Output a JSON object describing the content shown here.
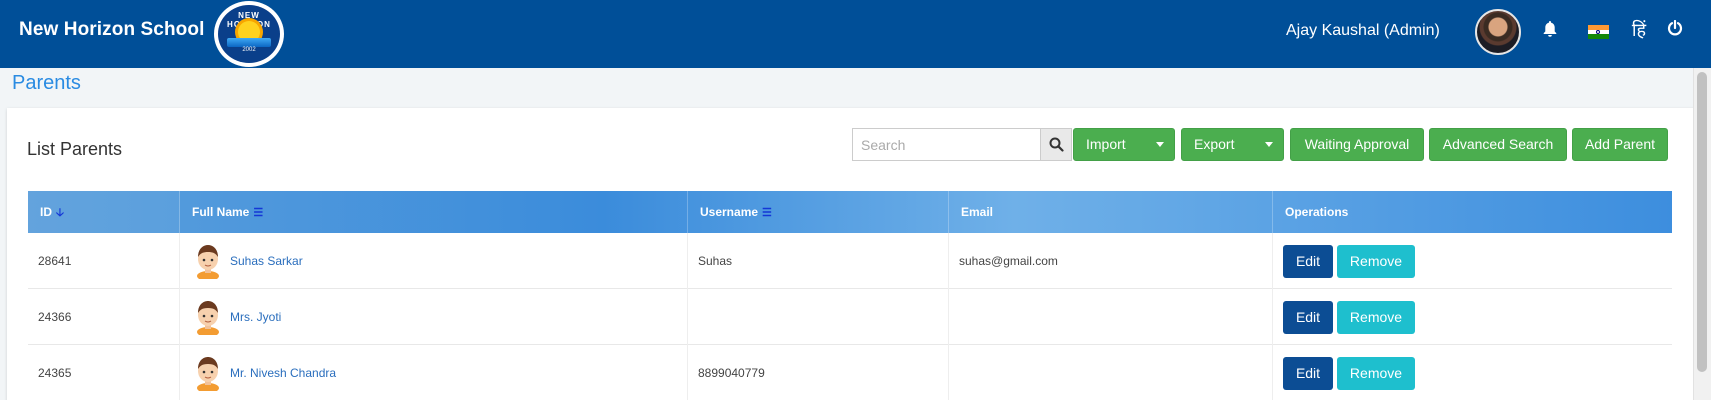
{
  "header": {
    "brand": "New Horizon School",
    "logo_text": "NEW HORIZON",
    "logo_year": "2002",
    "user_name": "Ajay Kaushal (Admin)",
    "icons": [
      "bell-icon",
      "india-flag-icon",
      "hindi-language-icon",
      "power-icon"
    ],
    "hindi_glyph": "हिं",
    "bar_color": "#004f98"
  },
  "page": {
    "title": "Parents",
    "card_title": "List Parents"
  },
  "toolbar": {
    "search_placeholder": "Search",
    "import_label": "Import",
    "export_label": "Export",
    "waiting_approval_label": "Waiting Approval",
    "advanced_search_label": "Advanced Search",
    "add_parent_label": "Add Parent",
    "button_color": "#4bae4f"
  },
  "table": {
    "columns": [
      "ID",
      "Full Name",
      "Username",
      "Email",
      "Operations"
    ],
    "rows": [
      {
        "id": "28641",
        "full_name": "Suhas Sarkar",
        "username": "Suhas",
        "email": "suhas@gmail.com"
      },
      {
        "id": "24366",
        "full_name": "Mrs. Jyoti",
        "username": "",
        "email": ""
      },
      {
        "id": "24365",
        "full_name": "Mr. Nivesh Chandra",
        "username": "8899040779",
        "email": ""
      }
    ],
    "edit_label": "Edit",
    "remove_label": "Remove"
  }
}
